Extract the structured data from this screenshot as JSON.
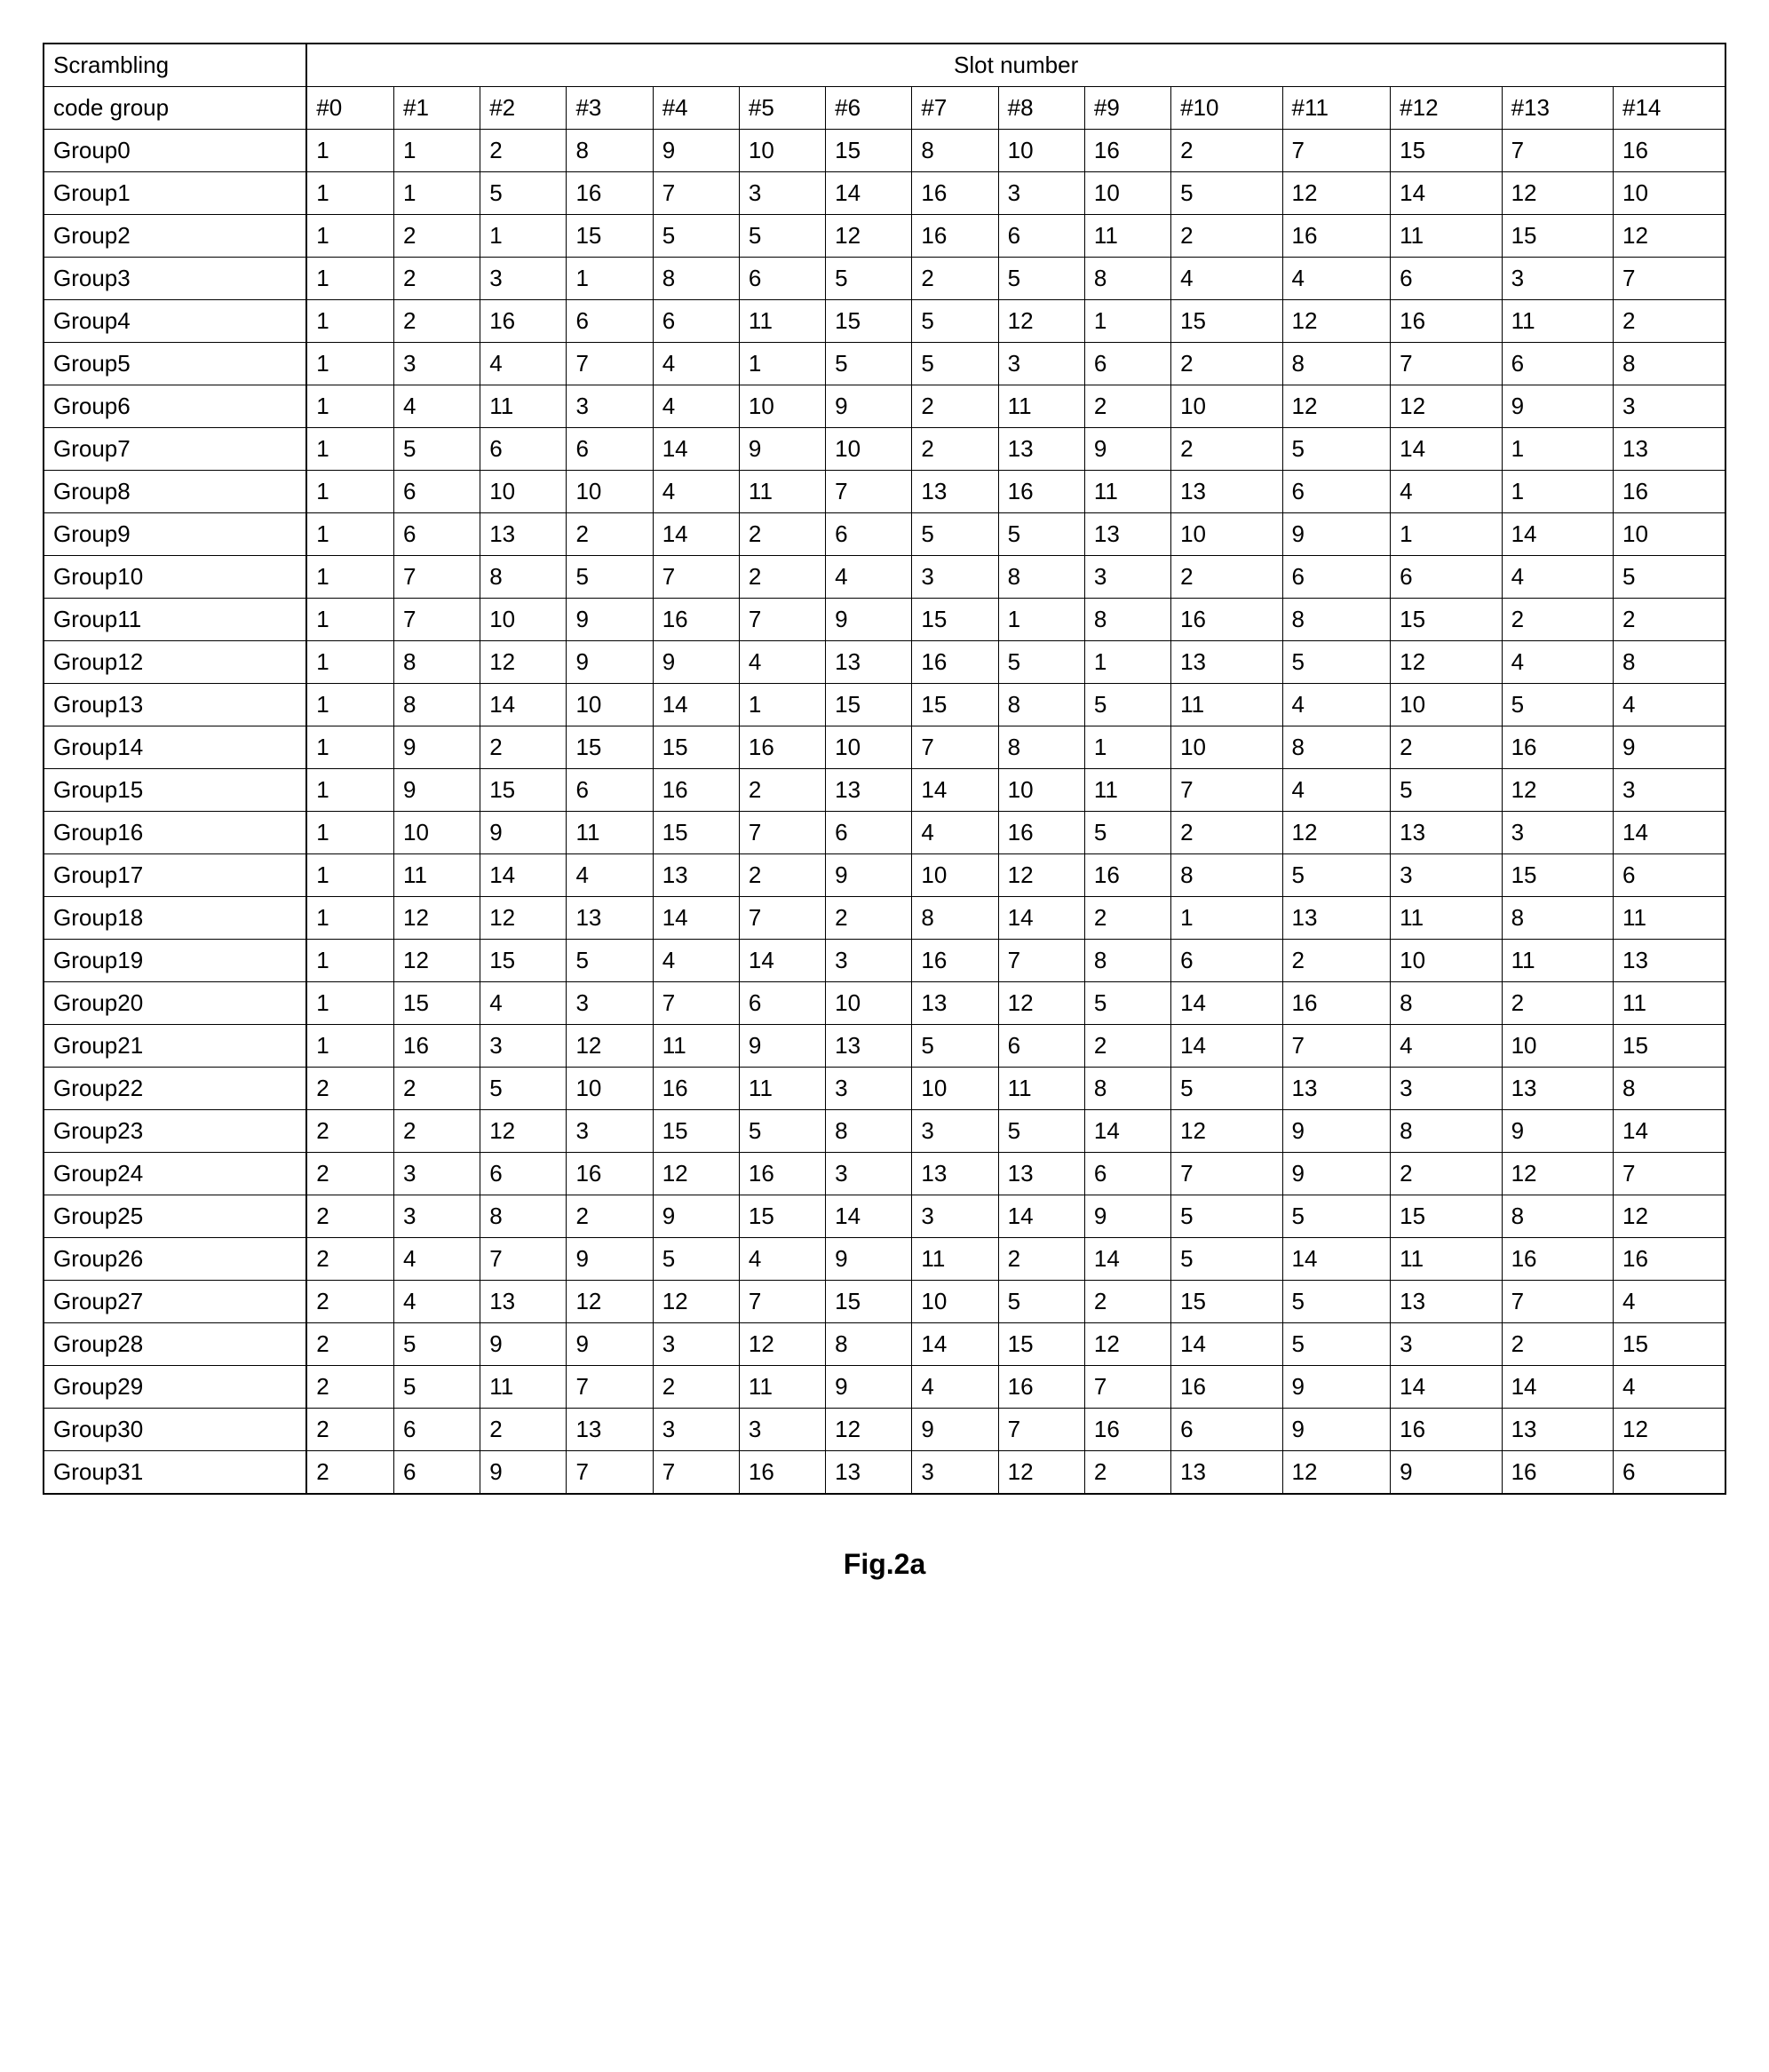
{
  "table": {
    "corner_top": "Scrambling",
    "corner_bottom": "code group",
    "slot_header": "Slot number",
    "columns": [
      "#0",
      "#1",
      "#2",
      "#3",
      "#4",
      "#5",
      "#6",
      "#7",
      "#8",
      "#9",
      "#10",
      "#11",
      "#12",
      "#13",
      "#14"
    ],
    "rows": [
      {
        "group": "Group0",
        "vals": [
          1,
          1,
          2,
          8,
          9,
          10,
          15,
          8,
          10,
          16,
          2,
          7,
          15,
          7,
          16
        ]
      },
      {
        "group": "Group1",
        "vals": [
          1,
          1,
          5,
          16,
          7,
          3,
          14,
          16,
          3,
          10,
          5,
          12,
          14,
          12,
          10
        ]
      },
      {
        "group": "Group2",
        "vals": [
          1,
          2,
          1,
          15,
          5,
          5,
          12,
          16,
          6,
          11,
          2,
          16,
          11,
          15,
          12
        ]
      },
      {
        "group": "Group3",
        "vals": [
          1,
          2,
          3,
          1,
          8,
          6,
          5,
          2,
          5,
          8,
          4,
          4,
          6,
          3,
          7
        ]
      },
      {
        "group": "Group4",
        "vals": [
          1,
          2,
          16,
          6,
          6,
          11,
          15,
          5,
          12,
          1,
          15,
          12,
          16,
          11,
          2
        ]
      },
      {
        "group": "Group5",
        "vals": [
          1,
          3,
          4,
          7,
          4,
          1,
          5,
          5,
          3,
          6,
          2,
          8,
          7,
          6,
          8
        ]
      },
      {
        "group": "Group6",
        "vals": [
          1,
          4,
          11,
          3,
          4,
          10,
          9,
          2,
          11,
          2,
          10,
          12,
          12,
          9,
          3
        ]
      },
      {
        "group": "Group7",
        "vals": [
          1,
          5,
          6,
          6,
          14,
          9,
          10,
          2,
          13,
          9,
          2,
          5,
          14,
          1,
          13
        ]
      },
      {
        "group": "Group8",
        "vals": [
          1,
          6,
          10,
          10,
          4,
          11,
          7,
          13,
          16,
          11,
          13,
          6,
          4,
          1,
          16
        ]
      },
      {
        "group": "Group9",
        "vals": [
          1,
          6,
          13,
          2,
          14,
          2,
          6,
          5,
          5,
          13,
          10,
          9,
          1,
          14,
          10
        ]
      },
      {
        "group": "Group10",
        "vals": [
          1,
          7,
          8,
          5,
          7,
          2,
          4,
          3,
          8,
          3,
          2,
          6,
          6,
          4,
          5
        ]
      },
      {
        "group": "Group11",
        "vals": [
          1,
          7,
          10,
          9,
          16,
          7,
          9,
          15,
          1,
          8,
          16,
          8,
          15,
          2,
          2
        ]
      },
      {
        "group": "Group12",
        "vals": [
          1,
          8,
          12,
          9,
          9,
          4,
          13,
          16,
          5,
          1,
          13,
          5,
          12,
          4,
          8
        ]
      },
      {
        "group": "Group13",
        "vals": [
          1,
          8,
          14,
          10,
          14,
          1,
          15,
          15,
          8,
          5,
          11,
          4,
          10,
          5,
          4
        ]
      },
      {
        "group": "Group14",
        "vals": [
          1,
          9,
          2,
          15,
          15,
          16,
          10,
          7,
          8,
          1,
          10,
          8,
          2,
          16,
          9
        ]
      },
      {
        "group": "Group15",
        "vals": [
          1,
          9,
          15,
          6,
          16,
          2,
          13,
          14,
          10,
          11,
          7,
          4,
          5,
          12,
          3
        ]
      },
      {
        "group": "Group16",
        "vals": [
          1,
          10,
          9,
          11,
          15,
          7,
          6,
          4,
          16,
          5,
          2,
          12,
          13,
          3,
          14
        ]
      },
      {
        "group": "Group17",
        "vals": [
          1,
          11,
          14,
          4,
          13,
          2,
          9,
          10,
          12,
          16,
          8,
          5,
          3,
          15,
          6
        ]
      },
      {
        "group": "Group18",
        "vals": [
          1,
          12,
          12,
          13,
          14,
          7,
          2,
          8,
          14,
          2,
          1,
          13,
          11,
          8,
          11
        ]
      },
      {
        "group": "Group19",
        "vals": [
          1,
          12,
          15,
          5,
          4,
          14,
          3,
          16,
          7,
          8,
          6,
          2,
          10,
          11,
          13
        ]
      },
      {
        "group": "Group20",
        "vals": [
          1,
          15,
          4,
          3,
          7,
          6,
          10,
          13,
          12,
          5,
          14,
          16,
          8,
          2,
          11
        ]
      },
      {
        "group": "Group21",
        "vals": [
          1,
          16,
          3,
          12,
          11,
          9,
          13,
          5,
          6,
          2,
          14,
          7,
          4,
          10,
          15
        ]
      },
      {
        "group": "Group22",
        "vals": [
          2,
          2,
          5,
          10,
          16,
          11,
          3,
          10,
          11,
          8,
          5,
          13,
          3,
          13,
          8
        ]
      },
      {
        "group": "Group23",
        "vals": [
          2,
          2,
          12,
          3,
          15,
          5,
          8,
          3,
          5,
          14,
          12,
          9,
          8,
          9,
          14
        ]
      },
      {
        "group": "Group24",
        "vals": [
          2,
          3,
          6,
          16,
          12,
          16,
          3,
          13,
          13,
          6,
          7,
          9,
          2,
          12,
          7
        ]
      },
      {
        "group": "Group25",
        "vals": [
          2,
          3,
          8,
          2,
          9,
          15,
          14,
          3,
          14,
          9,
          5,
          5,
          15,
          8,
          12
        ]
      },
      {
        "group": "Group26",
        "vals": [
          2,
          4,
          7,
          9,
          5,
          4,
          9,
          11,
          2,
          14,
          5,
          14,
          11,
          16,
          16
        ]
      },
      {
        "group": "Group27",
        "vals": [
          2,
          4,
          13,
          12,
          12,
          7,
          15,
          10,
          5,
          2,
          15,
          5,
          13,
          7,
          4
        ]
      },
      {
        "group": "Group28",
        "vals": [
          2,
          5,
          9,
          9,
          3,
          12,
          8,
          14,
          15,
          12,
          14,
          5,
          3,
          2,
          15
        ]
      },
      {
        "group": "Group29",
        "vals": [
          2,
          5,
          11,
          7,
          2,
          11,
          9,
          4,
          16,
          7,
          16,
          9,
          14,
          14,
          4
        ]
      },
      {
        "group": "Group30",
        "vals": [
          2,
          6,
          2,
          13,
          3,
          3,
          12,
          9,
          7,
          16,
          6,
          9,
          16,
          13,
          12
        ]
      },
      {
        "group": "Group31",
        "vals": [
          2,
          6,
          9,
          7,
          7,
          16,
          13,
          3,
          12,
          2,
          13,
          12,
          9,
          16,
          6
        ]
      }
    ]
  },
  "caption": "Fig.2a"
}
